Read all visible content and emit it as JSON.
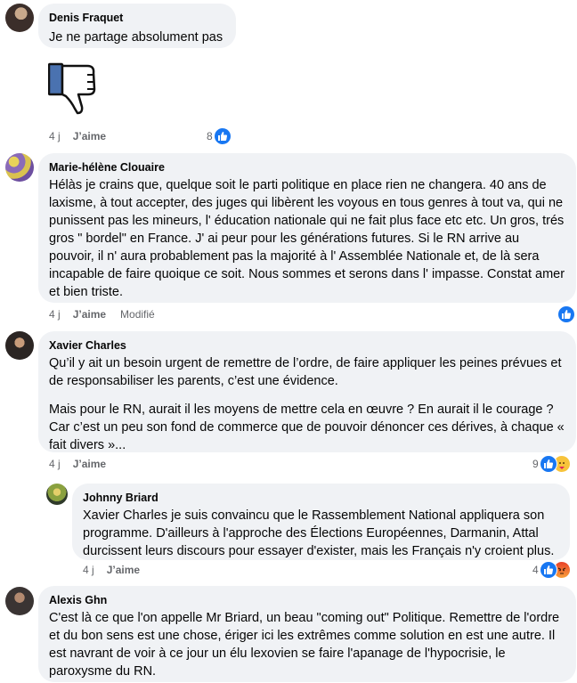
{
  "comments": [
    {
      "author": "Denis Fraquet",
      "text": "Je ne partage absolument pas",
      "time": "4 j",
      "like_label": "J’aime",
      "reaction_count": "8"
    },
    {
      "author": "Marie-hélène Clouaire",
      "text": "Hélàs je crains que, quelque soit le parti politique en place rien ne changera. 40 ans de laxisme, à tout accepter, des juges qui libèrent les voyous en tous genres à tout va, qui ne punissent pas les mineurs, l' éducation nationale qui ne fait plus face etc etc. Un gros, trés gros \" bordel\" en France. J' ai peur pour les générations futures. Si le RN arrive au pouvoir, il n' aura probablement pas la majorité à l' Assemblée Nationale et, de là sera incapable de faire quoique ce soit. Nous sommes et serons dans l' impasse. Constat amer et bien triste.",
      "time": "4 j",
      "like_label": "J’aime",
      "edited": "Modifié"
    },
    {
      "author": "Xavier Charles",
      "para1": "Qu’il y ait un besoin urgent de remettre de l’ordre, de faire appliquer les peines prévues et de responsabiliser les parents, c’est une évidence.",
      "para2": "Mais pour le RN, aurait il les moyens de mettre cela en œuvre ? En aurait il le courage ? Car c’est un peu son fond de commerce que de pouvoir dénoncer ces dérives, à chaque « fait divers »...",
      "time": "4 j",
      "like_label": "J’aime",
      "reaction_count": "9"
    },
    {
      "author": "Johnny Briard",
      "mention": "Xavier Charles",
      "text": " je suis convaincu que le Rassemblement National appliquera son programme. D'ailleurs à l'approche des Élections Européennes, Darmanin, Attal durcissent leurs discours pour essayer d'exister, mais les Français n'y croient plus.",
      "time": "4 j",
      "like_label": "J’aime",
      "reaction_count": "4"
    },
    {
      "author": "Alexis Ghn",
      "text": "C'est là ce que l'on appelle Mr Briard, un beau \"coming out\" Politique. Remettre de l'ordre et du bon sens est une chose, ériger ici les extrêmes comme solution en est une autre. Il est navrant de voir à ce jour un élu lexovien se faire l'apanage de l'hypocrisie, le paroxysme du RN."
    }
  ],
  "colors": {
    "bubble": "#f0f2f5",
    "like_blue": "#1877f2",
    "angry": "#f0692a",
    "meta": "#65676b"
  },
  "icons": [
    "thumbs-down-sticker",
    "like-reaction-icon",
    "care-reaction-icon",
    "angry-reaction-icon"
  ]
}
